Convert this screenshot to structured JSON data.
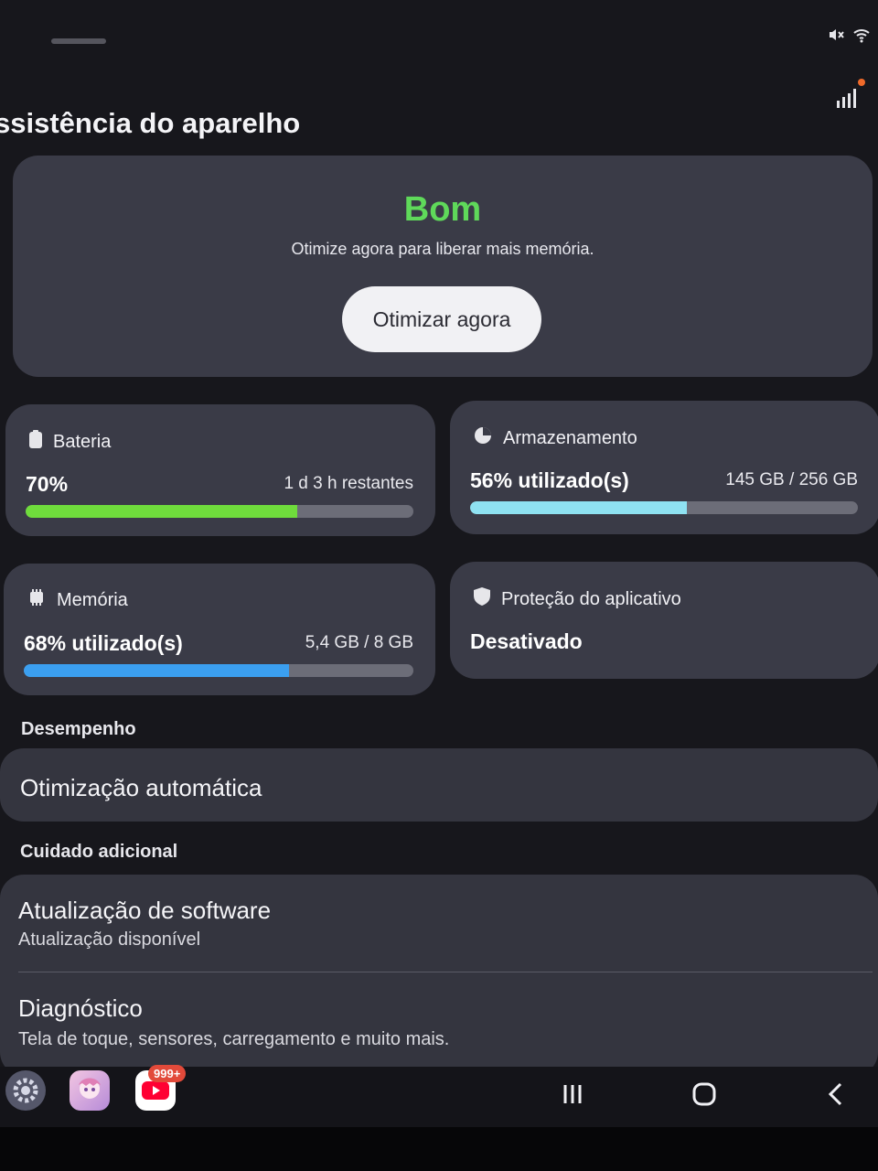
{
  "header": {
    "title": "ssistência do aparelho"
  },
  "summary": {
    "status": "Bom",
    "message": "Otimize agora para liberar mais memória.",
    "optimize_button": "Otimizar agora",
    "status_color": "#5fd95a"
  },
  "tiles": {
    "battery": {
      "label": "Bateria",
      "value": "70%",
      "detail": "1 d 3 h restantes",
      "level": 0.7,
      "color": "#6fdc3c"
    },
    "storage": {
      "label": "Armazenamento",
      "value": "56% utilizado(s)",
      "detail": "145 GB / 256 GB",
      "level": 0.56,
      "color": "#8fe2f2"
    },
    "memory": {
      "label": "Memória",
      "value": "68% utilizado(s)",
      "detail": "5,4 GB / 8 GB",
      "level": 0.68,
      "color": "#3b9ff0"
    },
    "protection": {
      "label": "Proteção do aplicativo",
      "value": "Desativado"
    }
  },
  "sections": {
    "performance": {
      "header": "Desempenho",
      "items": [
        {
          "title": "Otimização automática"
        }
      ]
    },
    "additional_care": {
      "header": "Cuidado adicional",
      "items": [
        {
          "title": "Atualização de software",
          "subtitle": "Atualização disponível"
        },
        {
          "title": "Diagnóstico",
          "subtitle": "Tela de toque, sensores, carregamento e muito mais."
        }
      ]
    }
  },
  "taskbar": {
    "apps": [
      "settings-app-icon",
      "game-app-icon",
      "youtube-app-icon"
    ],
    "youtube_badge": "999+"
  },
  "nav": {
    "icons": [
      "recents-icon",
      "home-icon",
      "back-icon"
    ]
  }
}
